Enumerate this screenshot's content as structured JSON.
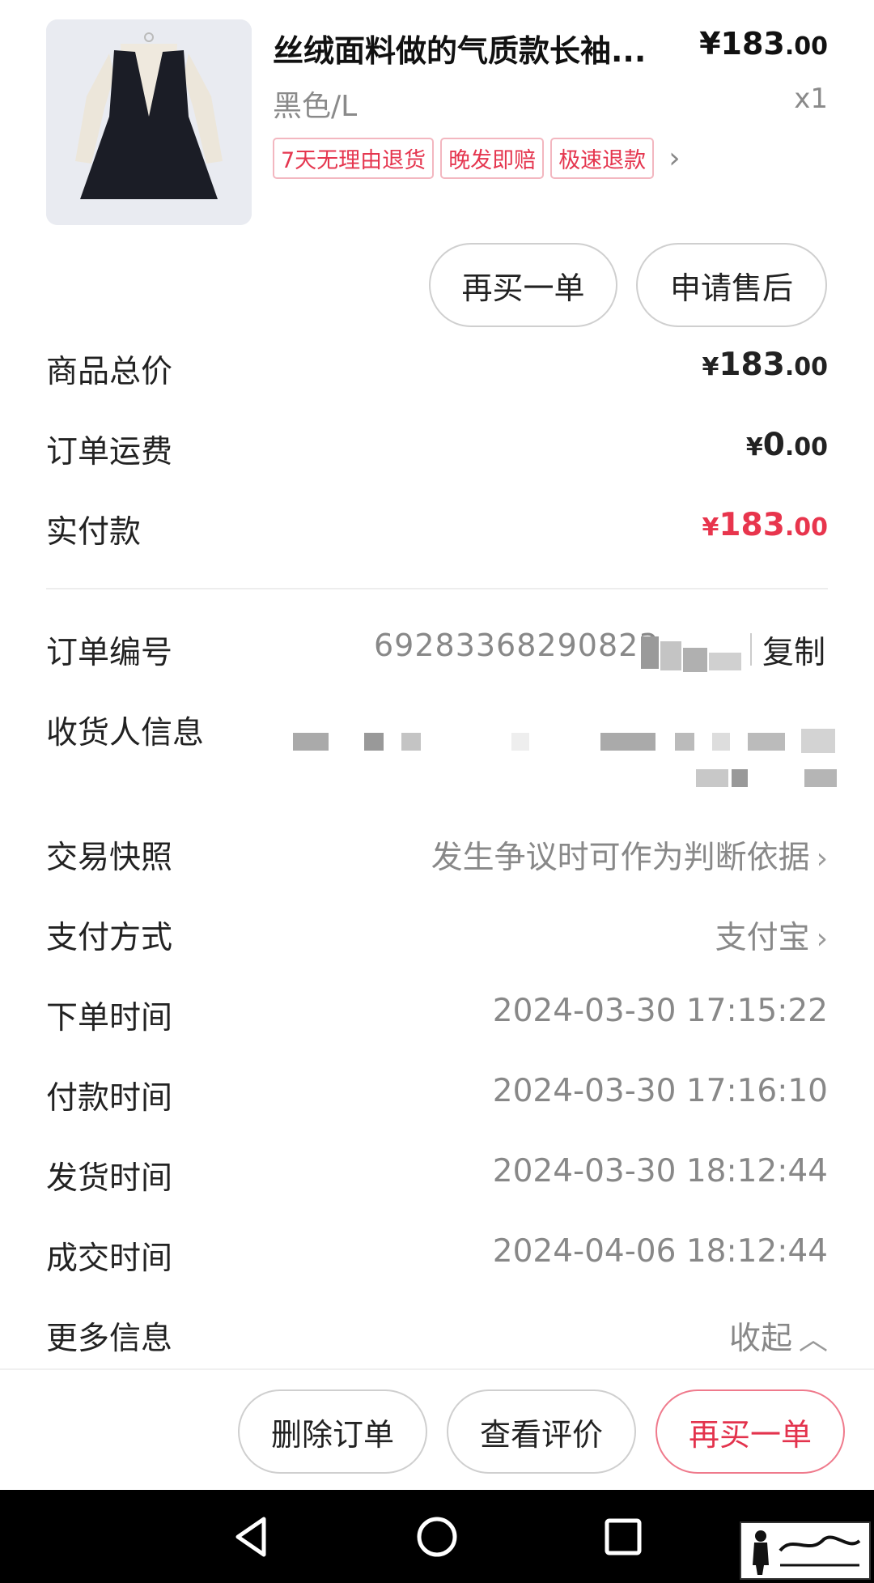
{
  "product": {
    "title": "丝绒面料做的气质款长袖...",
    "price_int": "¥183",
    "price_dec": ".00",
    "spec": "黑色/L",
    "qty": "x1",
    "tags": [
      "7天无理由退货",
      "晚发即赔",
      "极速退款"
    ],
    "tags_more": "›"
  },
  "item_actions": {
    "rebuy": "再买一单",
    "after_sale": "申请售后"
  },
  "totals": {
    "goods_total_label": "商品总价",
    "goods_total_yen": "¥",
    "goods_total_int": "183",
    "goods_total_dec": ".00",
    "shipping_label": "订单运费",
    "shipping_yen": "¥",
    "shipping_int": "0",
    "shipping_dec": ".00",
    "paid_label": "实付款",
    "paid_yen": "¥",
    "paid_int": "183",
    "paid_dec": ".00"
  },
  "details": {
    "order_no_label": "订单编号",
    "order_no": "69283368290823",
    "copy": "复制",
    "receiver_label": "收货人信息",
    "snapshot_label": "交易快照",
    "snapshot_value": "发生争议时可作为判断依据",
    "payment_label": "支付方式",
    "payment_value": "支付宝",
    "order_time_label": "下单时间",
    "order_time": "2024-03-30 17:15:22",
    "pay_time_label": "付款时间",
    "pay_time": "2024-03-30 17:16:10",
    "ship_time_label": "发货时间",
    "ship_time": "2024-03-30 18:12:44",
    "deal_time_label": "成交时间",
    "deal_time": "2024-04-06 18:12:44",
    "more_label": "更多信息",
    "more_value": "收起"
  },
  "bottom_actions": {
    "delete": "删除订单",
    "view_review": "查看评价",
    "rebuy": "再买一单"
  },
  "colors": {
    "accent": "#e8354d",
    "tag_border": "#f3b7c0",
    "muted": "#888888"
  }
}
